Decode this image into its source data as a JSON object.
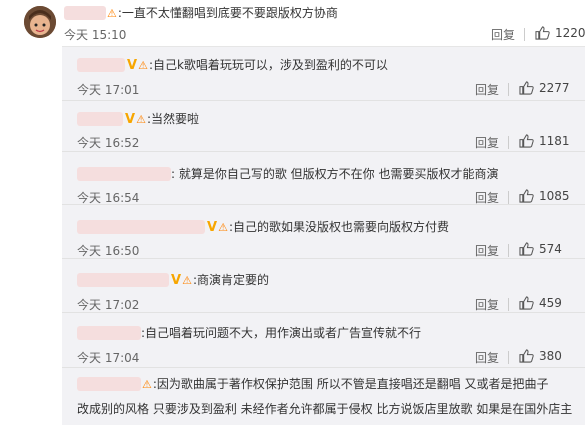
{
  "main_comment": {
    "text": ":一直不太懂翻唱到底要不要跟版权方协商",
    "time": "今天 15:10",
    "reply_label": "回复",
    "like_count": "1220"
  },
  "replies": [
    {
      "text": ":自己k歌唱着玩玩可以，涉及到盈利的不可以",
      "time": "今天 17:01",
      "reply_label": "回复",
      "like_count": "2277"
    },
    {
      "text": ":当然要啦",
      "time": "今天 16:52",
      "reply_label": "回复",
      "like_count": "1181"
    },
    {
      "text": ": 就算是你自己写的歌 但版权方不在你 也需要买版权才能商演",
      "time": "今天 16:54",
      "reply_label": "回复",
      "like_count": "1085"
    },
    {
      "text": ":自己的歌如果没版权也需要向版权方付费",
      "time": "今天 16:50",
      "reply_label": "回复",
      "like_count": "574"
    },
    {
      "text": ":商演肯定要的",
      "time": "今天 17:02",
      "reply_label": "回复",
      "like_count": "459"
    },
    {
      "text": ":自己唱着玩问题不大，用作演出或者广告宣传就不行",
      "time": "今天 17:04",
      "reply_label": "回复",
      "like_count": "380"
    },
    {
      "text_line1": ":因为歌曲属于著作权保护范围 所以不管是直接唱还是翻唱 又或者是把曲子",
      "text_line2": "改成别的风格 只要涉及到盈利 未经作者允许都属于侵权 比方说饭店里放歌 如果是在国外店主"
    }
  ],
  "badge_text": "V",
  "colors": {
    "panel_bg": "#f2f2f5",
    "blur": "#f5dede",
    "vip": "#f7a600",
    "badge": "#ff8200"
  }
}
